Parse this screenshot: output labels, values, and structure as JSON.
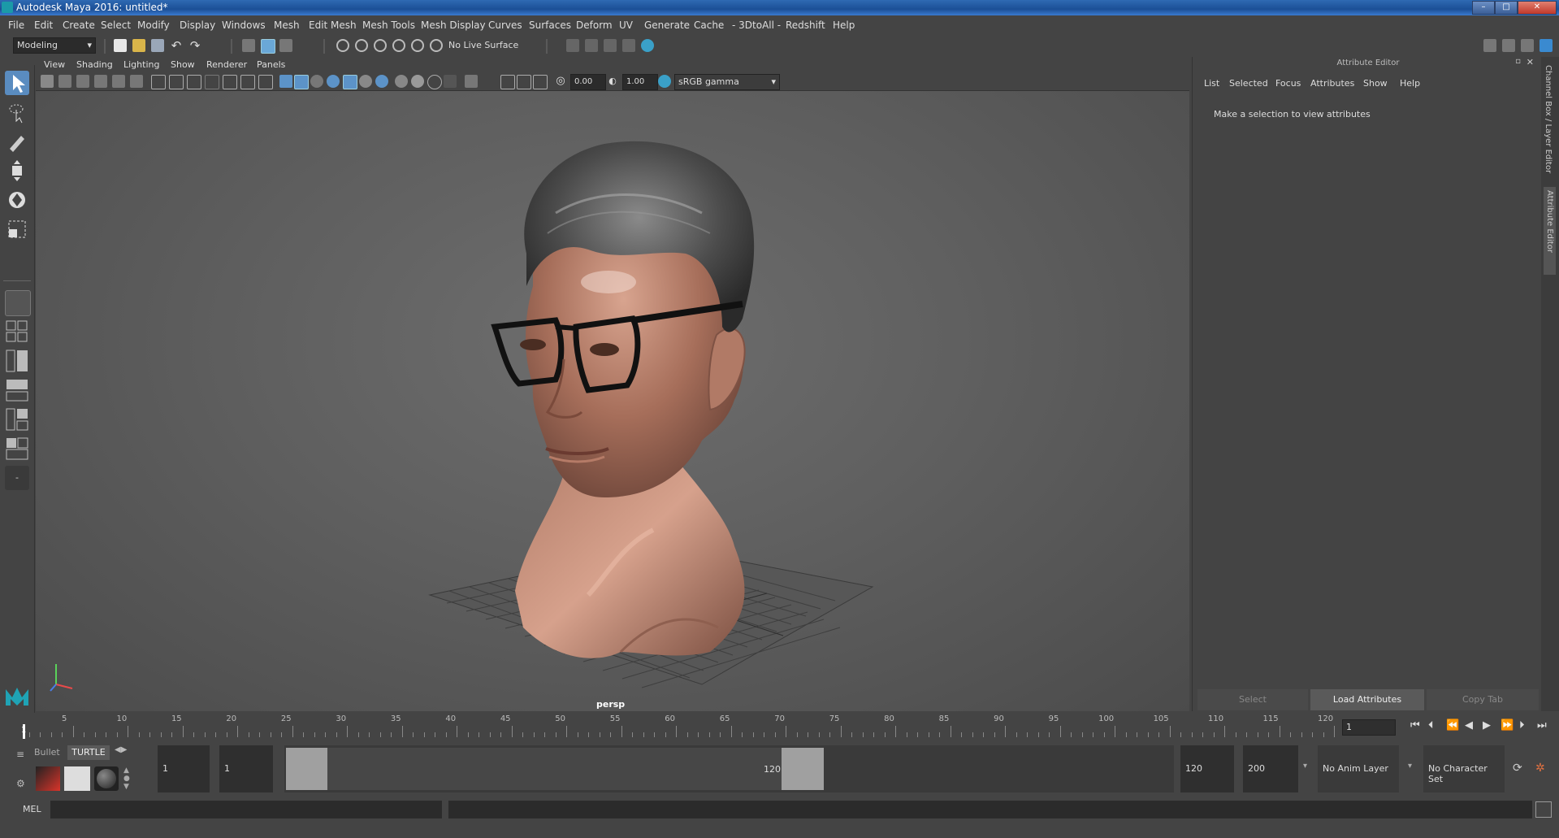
{
  "window": {
    "title": "Autodesk Maya 2016: untitled*"
  },
  "menubar": [
    "File",
    "Edit",
    "Create",
    "Select",
    "Modify",
    "Display",
    "Windows",
    "Mesh",
    "Edit Mesh",
    "Mesh Tools",
    "Mesh Display",
    "Curves",
    "Surfaces",
    "Deform",
    "UV",
    "Generate",
    "Cache",
    "- 3DtoAll -",
    "Redshift",
    "Help"
  ],
  "statusline": {
    "mode": "Modeling",
    "live_surface": "No Live Surface"
  },
  "viewport": {
    "menus": [
      "View",
      "Shading",
      "Lighting",
      "Show",
      "Renderer",
      "Panels"
    ],
    "exposure": "0.00",
    "gamma": "1.00",
    "color_space": "sRGB gamma",
    "camera": "persp"
  },
  "attribute_editor": {
    "title": "Attribute Editor",
    "menus": [
      "List",
      "Selected",
      "Focus",
      "Attributes",
      "Show",
      "Help"
    ],
    "message": "Make a selection to view attributes",
    "buttons": {
      "select": "Select",
      "load": "Load Attributes",
      "copy": "Copy Tab"
    },
    "side_tabs": [
      "Channel Box / Layer Editor",
      "Attribute Editor"
    ]
  },
  "timeslider": {
    "ticks": [
      "5",
      "10",
      "15",
      "20",
      "25",
      "30",
      "35",
      "40",
      "45",
      "50",
      "55",
      "60",
      "65",
      "70",
      "75",
      "80",
      "85",
      "90",
      "95",
      "100",
      "105",
      "110",
      "115",
      "120"
    ],
    "current_frame_marker": "1",
    "current_frame": "1"
  },
  "range": {
    "shelf_tabs": [
      "Bullet",
      "TURTLE"
    ],
    "start": "1",
    "playback_start": "1",
    "slider_start": "1",
    "slider_end": "120",
    "playback_end": "120",
    "end": "200",
    "anim_layer": "No Anim Layer",
    "character_set": "No Character Set"
  },
  "commandline": {
    "label": "MEL"
  }
}
